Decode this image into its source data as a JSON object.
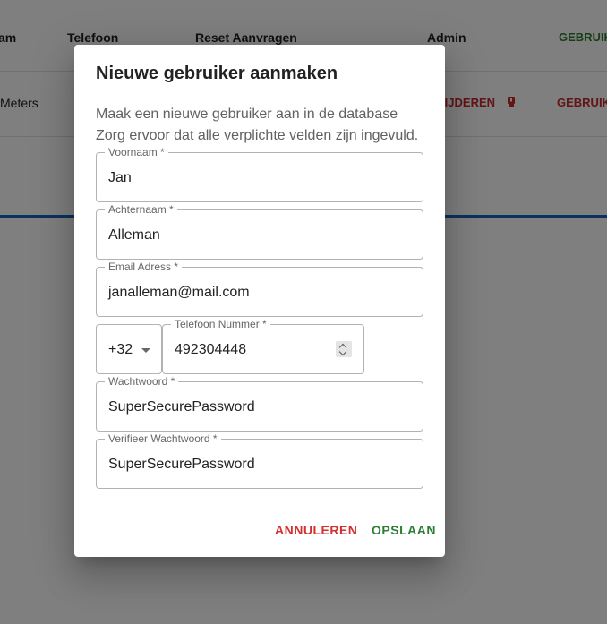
{
  "background": {
    "header_cells": [
      "am",
      "Telefoon",
      "Reset Aanvragen",
      "Admin",
      "GEBRUIK"
    ],
    "row_cells": {
      "first": "Meters",
      "delete": "VIJDEREN",
      "role": "GEBRUIK"
    }
  },
  "dialog": {
    "title": "Nieuwe gebruiker aanmaken",
    "text_line1": "Maak een nieuwe gebruiker aan in de database",
    "text_line2": "Zorg ervoor dat alle verplichte velden zijn ingevuld.",
    "fields": {
      "firstname": {
        "label": "Voornaam *",
        "value": "Jan"
      },
      "lastname": {
        "label": "Achternaam *",
        "value": "Alleman"
      },
      "email": {
        "label": "Email Adress *",
        "value": "janalleman@mail.com"
      },
      "country_code": {
        "value": "+32"
      },
      "phone": {
        "label": "Telefoon Nummer *",
        "value": "492304448"
      },
      "password": {
        "label": "Wachtwoord *",
        "value": "SuperSecurePassword"
      },
      "password_verify": {
        "label": "Verifieer Wachtwoord *",
        "value": "SuperSecurePassword"
      }
    },
    "buttons": {
      "cancel": "ANNULEREN",
      "save": "OPSLAAN"
    }
  },
  "colors": {
    "cancel": "#d32f2f",
    "save": "#2e7d32",
    "overlay": "rgba(0,0,0,0.5)",
    "accent_line": "#1565c0"
  },
  "icons": {
    "delete": "delete-alert-icon",
    "select": "chevron-down-icon",
    "spinner": "number-spinner-icon"
  }
}
